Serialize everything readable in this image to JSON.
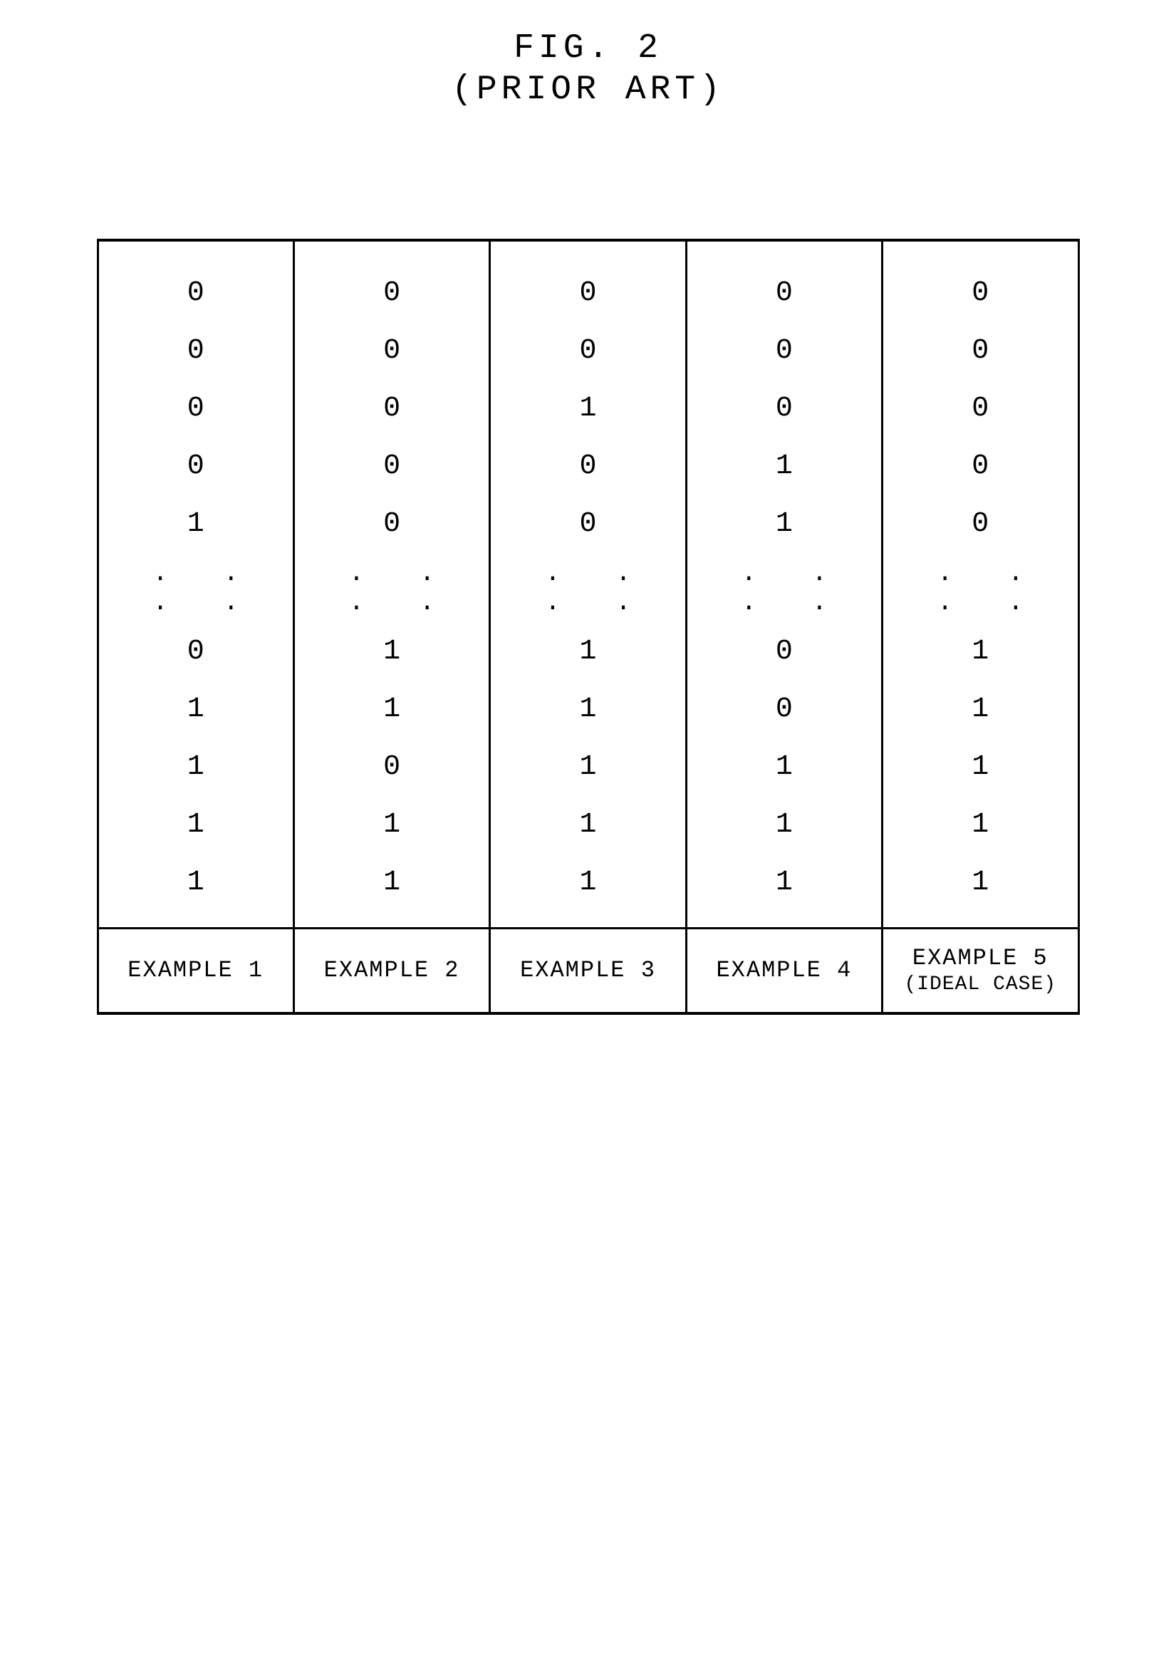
{
  "title_line1": "FIG. 2",
  "title_line2": "(PRIOR ART)",
  "chart_data": {
    "type": "table",
    "columns": [
      {
        "label": "EXAMPLE 1",
        "sub": ""
      },
      {
        "label": "EXAMPLE 2",
        "sub": ""
      },
      {
        "label": "EXAMPLE 3",
        "sub": ""
      },
      {
        "label": "EXAMPLE 4",
        "sub": ""
      },
      {
        "label": "EXAMPLE 5",
        "sub": "(IDEAL CASE)"
      }
    ],
    "top_rows": [
      [
        "0",
        "0",
        "0",
        "0",
        "0"
      ],
      [
        "0",
        "0",
        "0",
        "0",
        "0"
      ],
      [
        "0",
        "0",
        "1",
        "0",
        "0"
      ],
      [
        "0",
        "0",
        "0",
        "1",
        "0"
      ],
      [
        "1",
        "0",
        "0",
        "1",
        "0"
      ]
    ],
    "ellipsis": ". . . .",
    "bottom_rows": [
      [
        "0",
        "1",
        "1",
        "0",
        "1"
      ],
      [
        "1",
        "1",
        "1",
        "0",
        "1"
      ],
      [
        "1",
        "0",
        "1",
        "1",
        "1"
      ],
      [
        "1",
        "1",
        "1",
        "1",
        "1"
      ],
      [
        "1",
        "1",
        "1",
        "1",
        "1"
      ]
    ]
  }
}
